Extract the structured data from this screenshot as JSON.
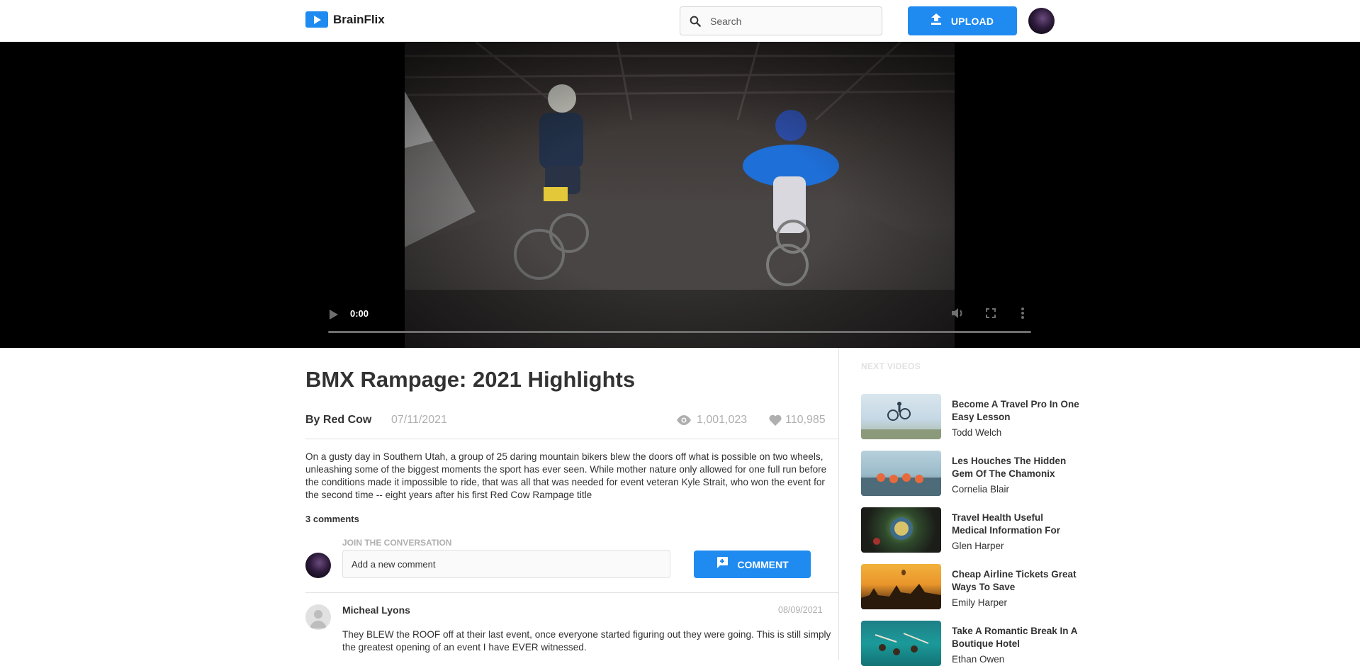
{
  "brand": {
    "name": "BrainFlix"
  },
  "search": {
    "placeholder": "Search"
  },
  "header": {
    "upload_label": "UPLOAD"
  },
  "player": {
    "time": "0:00"
  },
  "video": {
    "title": "BMX Rampage: 2021 Highlights",
    "author": "By Red Cow",
    "date": "07/11/2021",
    "views": "1,001,023",
    "likes": "110,985",
    "description": "On a gusty day in Southern Utah, a group of 25 daring mountain bikers blew the doors off what is possible on two wheels, unleashing some of the biggest moments the sport has ever seen. While mother nature only allowed for one full run before the conditions made it impossible to ride, that was all that was needed for event veteran Kyle Strait, who won the event for the second time -- eight years after his first Red Cow Rampage title"
  },
  "comments": {
    "count_label": "3 comments",
    "join_label": "JOIN THE CONVERSATION",
    "input_placeholder": "Add a new comment",
    "button_label": "COMMENT",
    "items": [
      {
        "name": "Micheal Lyons",
        "date": "08/09/2021",
        "text": "They BLEW the ROOF off at their last event, once everyone started figuring out they were going. This is still simply the greatest opening of an event I have EVER witnessed."
      }
    ]
  },
  "sidebar": {
    "heading": "NEXT VIDEOS",
    "videos": [
      {
        "title": "Become A Travel Pro In One Easy Lesson",
        "channel": "Todd Welch"
      },
      {
        "title": "Les Houches The Hidden Gem Of The Chamonix",
        "channel": "Cornelia Blair"
      },
      {
        "title": "Travel Health Useful Medical Information For",
        "channel": "Glen Harper"
      },
      {
        "title": "Cheap Airline Tickets Great Ways To Save",
        "channel": "Emily Harper"
      },
      {
        "title": "Take A Romantic Break In A Boutique Hotel",
        "channel": "Ethan Owen"
      }
    ]
  },
  "colors": {
    "accent": "#1f8bf0",
    "text": "#323232",
    "muted": "#afafaf",
    "border": "#e1e1e1"
  }
}
